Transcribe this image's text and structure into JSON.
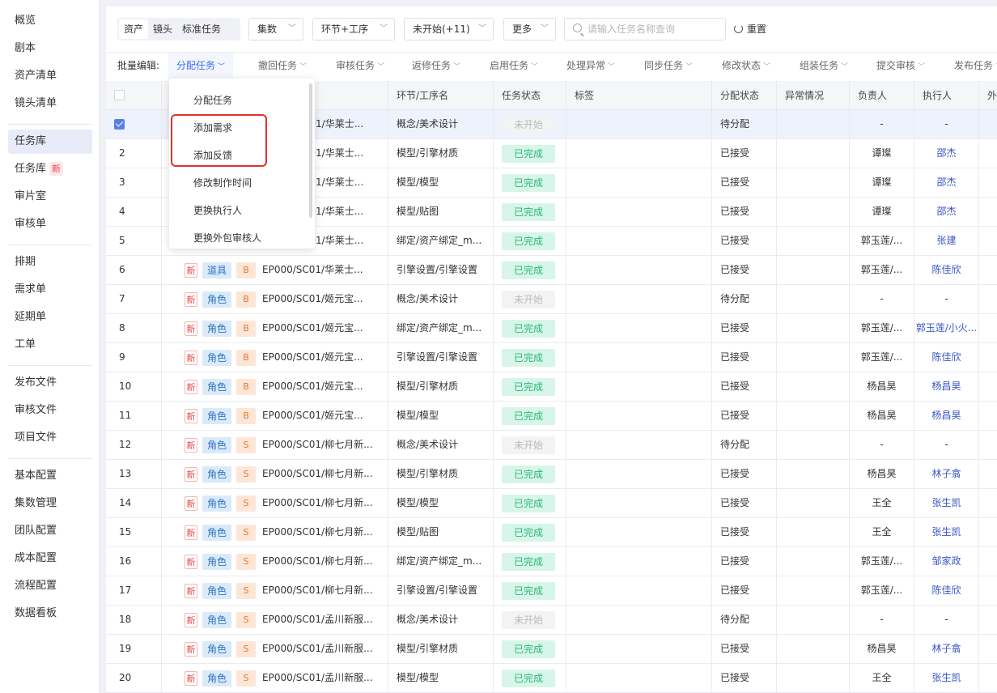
{
  "sidebar": {
    "groups": [
      [
        "概览",
        "剧本",
        "资产清单",
        "镜头清单"
      ],
      [
        "任务库",
        "任务库",
        "审片室",
        "审核单"
      ],
      [
        "排期",
        "需求单",
        "延期单",
        "工单"
      ],
      [
        "发布文件",
        "审核文件",
        "项目文件"
      ],
      [
        "基本配置",
        "集数管理",
        "团队配置",
        "成本配置",
        "流程配置",
        "数据看板"
      ]
    ],
    "new_badge": "新",
    "active": "任务库"
  },
  "filters": {
    "segments": [
      "资产",
      "镜头",
      "标准任务"
    ],
    "active_segment": "资产",
    "selects": [
      "集数",
      "环节+工序",
      "未开始(+11)",
      "更多"
    ],
    "search_placeholder": "请输入任务名称查询",
    "reset_label": "重置"
  },
  "batch": {
    "label": "批量编辑:",
    "items": [
      "分配任务",
      "撤回任务",
      "审核任务",
      "返修任务",
      "启用任务",
      "处理异常",
      "同步任务",
      "修改状态",
      "组装任务",
      "提交审核",
      "发布任务"
    ]
  },
  "dropdown": {
    "items": [
      "分配任务",
      "添加需求",
      "添加反馈",
      "修改制作时间",
      "更换执行人",
      "更换外包审核人"
    ]
  },
  "table": {
    "columns": [
      "",
      "",
      "环节/工序名",
      "任务状态",
      "标签",
      "分配状态",
      "异常情况",
      "负责人",
      "执行人",
      "外"
    ],
    "rows": [
      {
        "no": "",
        "checked": true,
        "new": "",
        "type": "",
        "grade": "",
        "asset": "C01/华莱士...",
        "step": "概念/美术设计",
        "status": "未开始",
        "assign": "待分配",
        "owner": "-",
        "exec": "-"
      },
      {
        "no": "2",
        "checked": false,
        "new": "",
        "type": "",
        "grade": "",
        "asset": "C01/华莱士...",
        "step": "模型/引擎材质",
        "status": "已完成",
        "assign": "已接受",
        "owner": "谭璨",
        "exec": "邵杰"
      },
      {
        "no": "3",
        "checked": false,
        "new": "",
        "type": "",
        "grade": "",
        "asset": "C01/华莱士...",
        "step": "模型/模型",
        "status": "已完成",
        "assign": "已接受",
        "owner": "谭璨",
        "exec": "邵杰"
      },
      {
        "no": "4",
        "checked": false,
        "new": "",
        "type": "",
        "grade": "",
        "asset": "C01/华莱士...",
        "step": "模型/贴图",
        "status": "已完成",
        "assign": "已接受",
        "owner": "谭璨",
        "exec": "邵杰"
      },
      {
        "no": "5",
        "checked": false,
        "new": "",
        "type": "",
        "grade": "",
        "asset": "C01/华莱士...",
        "step": "绑定/资产绑定_m...",
        "status": "已完成",
        "assign": "已接受",
        "owner": "郭玉莲/...",
        "exec": "张建"
      },
      {
        "no": "6",
        "checked": false,
        "new": "新",
        "type": "道具",
        "grade": "B",
        "asset": "EP000/SC01/华莱士...",
        "step": "引擎设置/引擎设置",
        "status": "已完成",
        "assign": "已接受",
        "owner": "郭玉莲/...",
        "exec": "陈佳欣"
      },
      {
        "no": "7",
        "checked": false,
        "new": "新",
        "type": "角色",
        "grade": "B",
        "asset": "EP000/SC01/姬元宝...",
        "step": "概念/美术设计",
        "status": "未开始",
        "assign": "待分配",
        "owner": "-",
        "exec": "-"
      },
      {
        "no": "8",
        "checked": false,
        "new": "新",
        "type": "角色",
        "grade": "B",
        "asset": "EP000/SC01/姬元宝...",
        "step": "绑定/资产绑定_m...",
        "status": "已完成",
        "assign": "已接受",
        "owner": "郭玉莲/...",
        "exec": "郭玉莲/小火..."
      },
      {
        "no": "9",
        "checked": false,
        "new": "新",
        "type": "角色",
        "grade": "B",
        "asset": "EP000/SC01/姬元宝...",
        "step": "引擎设置/引擎设置",
        "status": "已完成",
        "assign": "已接受",
        "owner": "郭玉莲/...",
        "exec": "陈佳欣"
      },
      {
        "no": "10",
        "checked": false,
        "new": "新",
        "type": "角色",
        "grade": "B",
        "asset": "EP000/SC01/姬元宝...",
        "step": "模型/引擎材质",
        "status": "已完成",
        "assign": "已接受",
        "owner": "杨昌昊",
        "exec": "杨昌昊"
      },
      {
        "no": "11",
        "checked": false,
        "new": "新",
        "type": "角色",
        "grade": "B",
        "asset": "EP000/SC01/姬元宝...",
        "step": "模型/模型",
        "status": "已完成",
        "assign": "已接受",
        "owner": "杨昌昊",
        "exec": "杨昌昊"
      },
      {
        "no": "12",
        "checked": false,
        "new": "新",
        "type": "角色",
        "grade": "S",
        "asset": "EP000/SC01/柳七月新...",
        "step": "概念/美术设计",
        "status": "未开始",
        "assign": "待分配",
        "owner": "-",
        "exec": "-"
      },
      {
        "no": "13",
        "checked": false,
        "new": "新",
        "type": "角色",
        "grade": "S",
        "asset": "EP000/SC01/柳七月新...",
        "step": "模型/引擎材质",
        "status": "已完成",
        "assign": "已接受",
        "owner": "杨昌昊",
        "exec": "林子翕"
      },
      {
        "no": "14",
        "checked": false,
        "new": "新",
        "type": "角色",
        "grade": "S",
        "asset": "EP000/SC01/柳七月新...",
        "step": "模型/模型",
        "status": "已完成",
        "assign": "已接受",
        "owner": "王全",
        "exec": "张生凯"
      },
      {
        "no": "15",
        "checked": false,
        "new": "新",
        "type": "角色",
        "grade": "S",
        "asset": "EP000/SC01/柳七月新...",
        "step": "模型/贴图",
        "status": "已完成",
        "assign": "已接受",
        "owner": "王全",
        "exec": "张生凯"
      },
      {
        "no": "16",
        "checked": false,
        "new": "新",
        "type": "角色",
        "grade": "S",
        "asset": "EP000/SC01/柳七月新...",
        "step": "绑定/资产绑定_m...",
        "status": "已完成",
        "assign": "已接受",
        "owner": "郭玉莲/...",
        "exec": "邹家政"
      },
      {
        "no": "17",
        "checked": false,
        "new": "新",
        "type": "角色",
        "grade": "S",
        "asset": "EP000/SC01/柳七月新...",
        "step": "引擎设置/引擎设置",
        "status": "已完成",
        "assign": "已接受",
        "owner": "郭玉莲/...",
        "exec": "陈佳欣"
      },
      {
        "no": "18",
        "checked": false,
        "new": "新",
        "type": "角色",
        "grade": "S",
        "asset": "EP000/SC01/孟川新服...",
        "step": "概念/美术设计",
        "status": "未开始",
        "assign": "待分配",
        "owner": "-",
        "exec": "-"
      },
      {
        "no": "19",
        "checked": false,
        "new": "新",
        "type": "角色",
        "grade": "S",
        "asset": "EP000/SC01/孟川新服...",
        "step": "模型/引擎材质",
        "status": "已完成",
        "assign": "已接受",
        "owner": "杨昌昊",
        "exec": "林子翕"
      },
      {
        "no": "20",
        "checked": false,
        "new": "新",
        "type": "角色",
        "grade": "S",
        "asset": "EP000/SC01/孟川新服...",
        "step": "模型/模型",
        "status": "已完成",
        "assign": "已接受",
        "owner": "王全",
        "exec": "张生凯"
      }
    ]
  }
}
